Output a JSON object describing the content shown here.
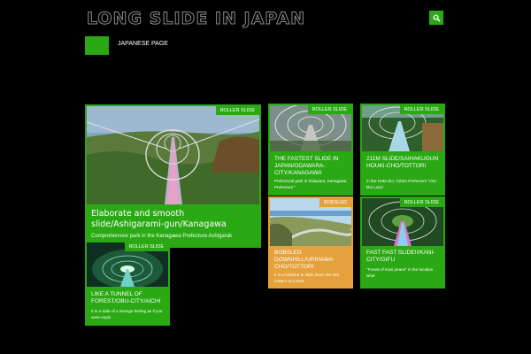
{
  "header": {
    "site_title": "LONG SLIDE IN JAPAN",
    "search_icon": "search-icon"
  },
  "nav": {
    "link_label": "JAPANESE PAGE"
  },
  "colors": {
    "accent_green": "#2aa915",
    "card_orange": "#e5a13b",
    "background": "#000000"
  },
  "cards": {
    "main": {
      "badge": "ROLLER SLIDE",
      "title": "Elaborate and smooth slide/Ashigarami-gun/Kanagawa",
      "excerpt": "Comprehensive park in the Kanagawa Prefecture Ashigarak"
    },
    "tunnel": {
      "badge": "ROLLER SLIDE",
      "title": "LIKE A TUNNEL OF FOREST/OBU-CITY/AICHI",
      "excerpt": "It is a slide of a strange feeling as if you were explo"
    },
    "fastest": {
      "badge": "ROLLER SLIDE",
      "title": "THE FASTEST SLIDE IN JAPAN/ODAWARA-CITY/KANAGAWA",
      "excerpt": "Prefectural park in Odawara, Kanagawa Prefecture \""
    },
    "m211": {
      "badge": "ROLLER SLIDE",
      "title": "211M SLIDE/SAIHAKUGUN HOUKI-CHO/TOTTORI",
      "excerpt": "In the Hoki-cho, Tottori Prefecture \"Oni-kko Land"
    },
    "bobsled": {
      "badge": "BOBSLED",
      "title": "BOBSLED DOWNHILL/URIHAMA-CHO/TOTTORI",
      "excerpt": "It is a bobsled to slide down the 540 meters at a stret"
    },
    "fastfast": {
      "badge": "ROLLER SLIDE",
      "title": "FAST FAST SLIDE!!/KANI-CITY/GIFU",
      "excerpt": "\"Forest of Kani peace\" in the location wher"
    }
  }
}
